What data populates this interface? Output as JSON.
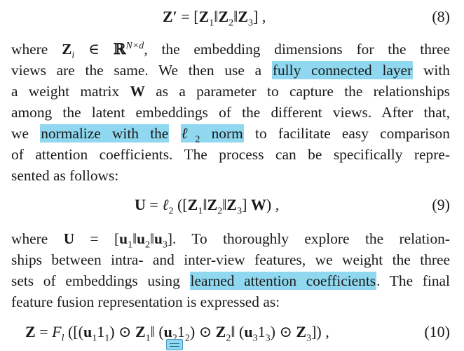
{
  "equations": {
    "eq8": {
      "lhs": "Z′",
      "rhs_parts": [
        "Z",
        "1",
        "‖",
        "Z",
        "2",
        "‖",
        "Z",
        "3"
      ],
      "number": "(8)"
    },
    "eq9": {
      "lhs": "U",
      "number": "(9)"
    },
    "eq10": {
      "lhs": "Z",
      "number": "(10)"
    }
  },
  "para1": {
    "l1_a": "where",
    "l1_b": ", the embedding dimensions for the three",
    "l2_a": "views are the same. We then use a",
    "l2_hl": "fully connected layer",
    "l2_b": "with",
    "l3_a": "a weight matrix",
    "l3_b": "as a parameter to capture the relationships",
    "l4": "among the latent embeddings of the different views. After that,",
    "l5_a": "we",
    "l5_hl": "normalize with the",
    "l5_hl2": "norm",
    "l5_b": "to facilitate easy comparison",
    "l6": "of attention coefficients. The process can be specifically repre-",
    "l7": "sented as follows:"
  },
  "para2": {
    "l1_a": "where",
    "l1_b": ". To thoroughly explore the relation-",
    "l2": "ships between intra- and inter-view features, we weight the three",
    "l3_a": "sets of embeddings using",
    "l3_hl": "learned attention coefficients",
    "l3_b": ". The final",
    "l4": "feature fusion representation is expressed as:"
  },
  "colors": {
    "highlight": "#8fd8f0",
    "note_icon": "#4a9cc2"
  },
  "icons": {
    "annotation": "note-icon"
  }
}
